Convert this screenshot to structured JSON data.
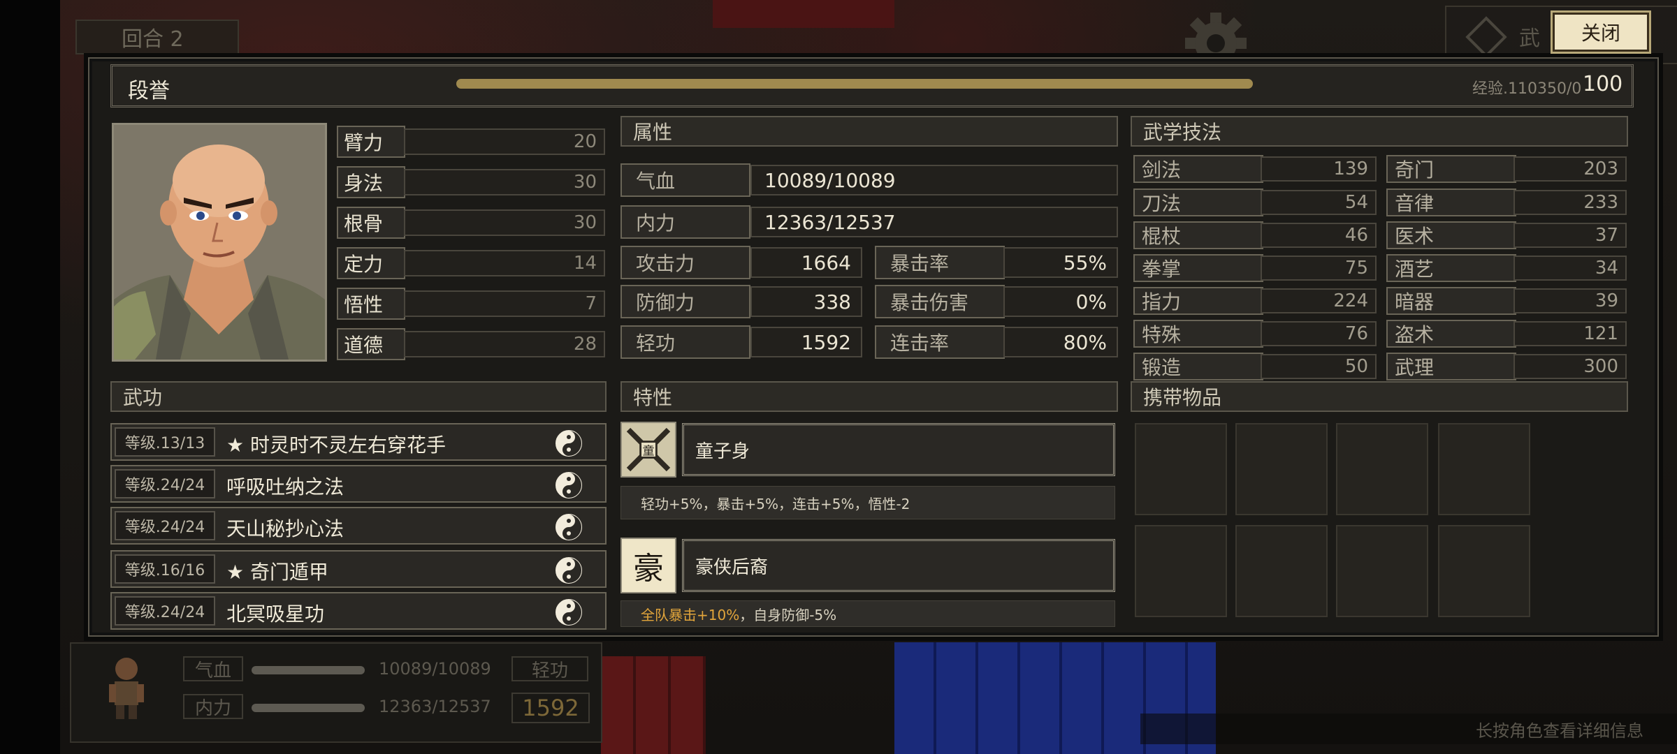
{
  "hud": {
    "round_label": "回合 2",
    "top_tab_text": "武",
    "close_label": "关闭"
  },
  "character": {
    "name": "段誉",
    "exp_label": "经验.110350/0",
    "level": "100",
    "exp_fraction": 1.0
  },
  "stats": [
    {
      "label": "臂力",
      "value": "20"
    },
    {
      "label": "身法",
      "value": "30"
    },
    {
      "label": "根骨",
      "value": "30"
    },
    {
      "label": "定力",
      "value": "14"
    },
    {
      "label": "悟性",
      "value": "7"
    },
    {
      "label": "道德",
      "value": "28"
    }
  ],
  "attributes": {
    "header": "属性",
    "hp": {
      "label": "气血",
      "value": "10089/10089"
    },
    "mp": {
      "label": "内力",
      "value": "12363/12537"
    },
    "attack": {
      "label": "攻击力",
      "value": "1664"
    },
    "crit_rate": {
      "label": "暴击率",
      "value": "55%"
    },
    "defense": {
      "label": "防御力",
      "value": "338"
    },
    "crit_damage": {
      "label": "暴击伤害",
      "value": "0%"
    },
    "agility": {
      "label": "轻功",
      "value": "1592"
    },
    "combo_rate": {
      "label": "连击率",
      "value": "80%"
    }
  },
  "skills": {
    "header": "武学技法",
    "left": [
      {
        "label": "剑法",
        "value": "139"
      },
      {
        "label": "刀法",
        "value": "54"
      },
      {
        "label": "棍杖",
        "value": "46"
      },
      {
        "label": "拳掌",
        "value": "75"
      },
      {
        "label": "指力",
        "value": "224"
      },
      {
        "label": "特殊",
        "value": "76"
      },
      {
        "label": "锻造",
        "value": "50"
      }
    ],
    "right": [
      {
        "label": "奇门",
        "value": "203"
      },
      {
        "label": "音律",
        "value": "233"
      },
      {
        "label": "医术",
        "value": "37"
      },
      {
        "label": "酒艺",
        "value": "34"
      },
      {
        "label": "暗器",
        "value": "39"
      },
      {
        "label": "盗术",
        "value": "121"
      },
      {
        "label": "武理",
        "value": "300"
      }
    ]
  },
  "martial_arts": {
    "header": "武功",
    "items": [
      {
        "level": "等级.13/13",
        "name": "★ 时灵时不灵左右穿花手"
      },
      {
        "level": "等级.24/24",
        "name": "呼吸吐纳之法"
      },
      {
        "level": "等级.24/24",
        "name": "天山秘抄心法"
      },
      {
        "level": "等级.16/16",
        "name": "★ 奇门遁甲"
      },
      {
        "level": "等级.24/24",
        "name": "北冥吸星功"
      }
    ]
  },
  "traits": {
    "header": "特性",
    "items": [
      {
        "name": "童子身",
        "desc": "轻功+5%，暴击+5%，连击+5%，悟性-2"
      },
      {
        "name": "豪侠后裔",
        "icon_char": "豪",
        "desc_highlight": "全队暴击+10%",
        "desc_rest": "，自身防御-5%"
      }
    ]
  },
  "inventory": {
    "header": "携带物品"
  },
  "bottom_hud": {
    "hp_label": "气血",
    "hp_value": "10089/10089",
    "mp_label": "内力",
    "mp_value": "12363/12537",
    "speed_label": "轻功",
    "speed_value": "1592"
  },
  "hint": "长按角色查看详细信息",
  "icons": {
    "settings": "gear-icon",
    "martial_art_type": "yin-yang-icon",
    "portrait": "character-portrait"
  },
  "colors": {
    "exp_bar": "#a08a4f",
    "highlight": "#e2a53b",
    "close_button_bg": "#efe4c4"
  }
}
